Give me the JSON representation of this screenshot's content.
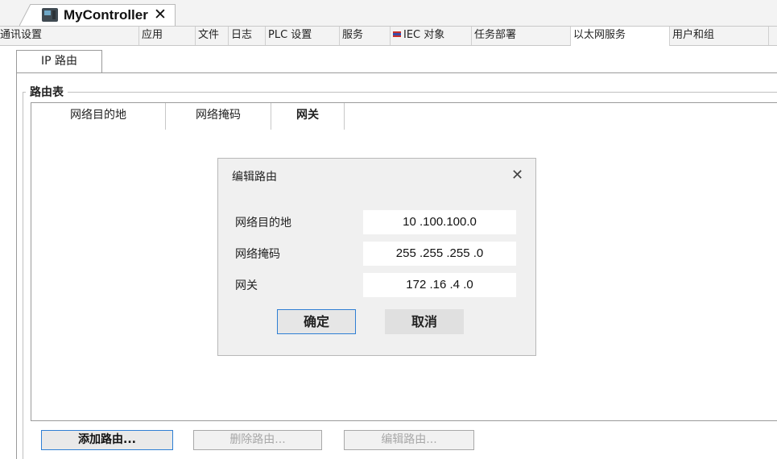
{
  "doc_tab": {
    "title": "MyController",
    "close": "✕"
  },
  "menu": [
    "通讯设置",
    "应用",
    "文件",
    "日志",
    "PLC 设置",
    "服务",
    "IEC 对象",
    "任务部署",
    "以太网服务",
    "用户和组"
  ],
  "sub_tab": "IP 路由",
  "group_title": "路由表",
  "table": {
    "headers": [
      "网络目的地",
      "网络掩码",
      "网关"
    ]
  },
  "buttons": {
    "add": "添加路由...",
    "delete": "删除路由...",
    "edit": "编辑路由..."
  },
  "dialog": {
    "title": "编辑路由",
    "close": "✕",
    "fields": [
      {
        "label": "网络目的地",
        "value": "10 .100.100.0"
      },
      {
        "label": "网络掩码",
        "value": "255 .255 .255 .0"
      },
      {
        "label": "网关",
        "value": "172 .16 .4 .0"
      }
    ],
    "ok": "确定",
    "cancel": "取消"
  },
  "colors": {
    "accent": "#2f7fd4",
    "iec_flag_blue": "#3a4ca8",
    "iec_flag_red": "#c8302a"
  }
}
